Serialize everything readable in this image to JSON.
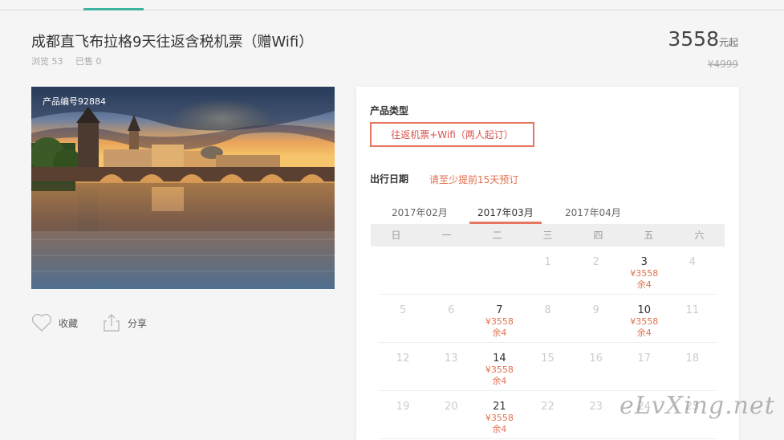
{
  "product": {
    "title": "成都直飞布拉格9天往返含税机票（赠Wifi）",
    "views": "浏览 53",
    "sold": "已售 0",
    "price": "3558",
    "price_unit": "元起",
    "original_price": "¥4999",
    "code_label": "产品编号92884"
  },
  "actions": {
    "favorite": "收藏",
    "share": "分享"
  },
  "booking": {
    "type_label": "产品类型",
    "type_option": "往返机票+Wifi（两人起订）",
    "date_label": "出行日期",
    "date_hint": "请至少提前15天预订",
    "months": [
      "2017年02月",
      "2017年03月",
      "2017年04月"
    ],
    "active_month_index": 1,
    "weekdays": [
      "日",
      "一",
      "二",
      "三",
      "四",
      "五",
      "六"
    ],
    "calendar": [
      [
        {
          "d": ""
        },
        {
          "d": ""
        },
        {
          "d": ""
        },
        {
          "d": "1"
        },
        {
          "d": "2"
        },
        {
          "d": "3",
          "price": "¥3558",
          "stock": "余4"
        },
        {
          "d": "4"
        }
      ],
      [
        {
          "d": "5"
        },
        {
          "d": "6"
        },
        {
          "d": "7",
          "price": "¥3558",
          "stock": "余4"
        },
        {
          "d": "8"
        },
        {
          "d": "9"
        },
        {
          "d": "10",
          "price": "¥3558",
          "stock": "余4"
        },
        {
          "d": "11"
        }
      ],
      [
        {
          "d": "12"
        },
        {
          "d": "13"
        },
        {
          "d": "14",
          "price": "¥3558",
          "stock": "余4"
        },
        {
          "d": "15"
        },
        {
          "d": "16"
        },
        {
          "d": "17"
        },
        {
          "d": "18"
        }
      ],
      [
        {
          "d": "19"
        },
        {
          "d": "20"
        },
        {
          "d": "21",
          "price": "¥3558",
          "stock": "余4"
        },
        {
          "d": "22"
        },
        {
          "d": "23"
        },
        {
          "d": "24"
        },
        {
          "d": "25"
        }
      ]
    ]
  },
  "watermark": "eLvXing.net",
  "colors": {
    "accent": "#e5765f",
    "tab_green": "#3fb39d"
  }
}
